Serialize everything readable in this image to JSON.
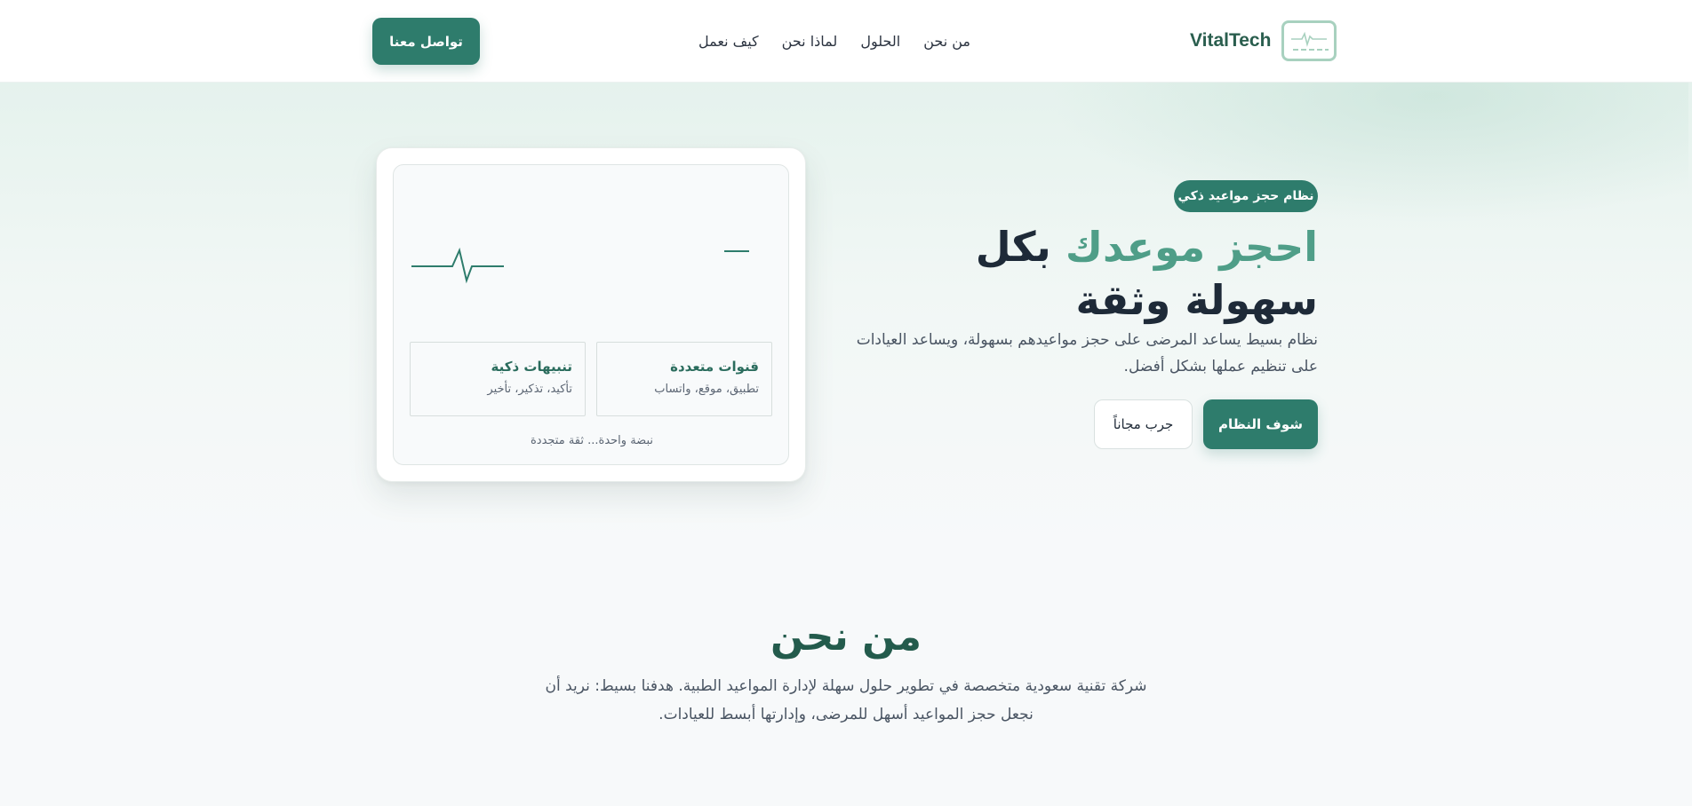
{
  "header": {
    "brand": "VitalTech",
    "nav": [
      "من نحن",
      "الحلول",
      "لماذا نحن",
      "كيف نعمل"
    ],
    "contact_label": "تواصل معنا"
  },
  "hero": {
    "badge": "نظام حجز مواعيد ذكي",
    "title_accent": "احجز موعدك",
    "title_rest": " بكل سهولة وثقة",
    "description": "نظام بسيط يساعد المرضى على حجز مواعيدهم بسهولة، ويساعد العيادات على تنظيم عملها بشكل أفضل.",
    "primary_button": "شوف النظام",
    "secondary_button": "جرب مجاناً"
  },
  "device": {
    "features": [
      {
        "title": "قنوات متعددة",
        "subtitle": "تطبيق، موقع، واتساب"
      },
      {
        "title": "تنبيهات ذكية",
        "subtitle": "تأكيد، تذكير، تأخير"
      }
    ],
    "tagline": "نبضة واحدة... ثقة متجددة"
  },
  "about": {
    "title": "من نحن",
    "description": "شركة تقنية سعودية متخصصة في تطوير حلول سهلة لإدارة المواعيد الطبية. هدفنا بسيط: نريد أن نجعل حجز المواعيد أسهل للمرضى، وإدارتها أبسط للعيادات."
  },
  "colors": {
    "primary": "#2e7c6c",
    "accent_text": "#4f9e88",
    "heading_dark": "#1e2a38"
  },
  "icons": [
    "monitor-pulse-icon",
    "heartbeat-line-icon"
  ]
}
